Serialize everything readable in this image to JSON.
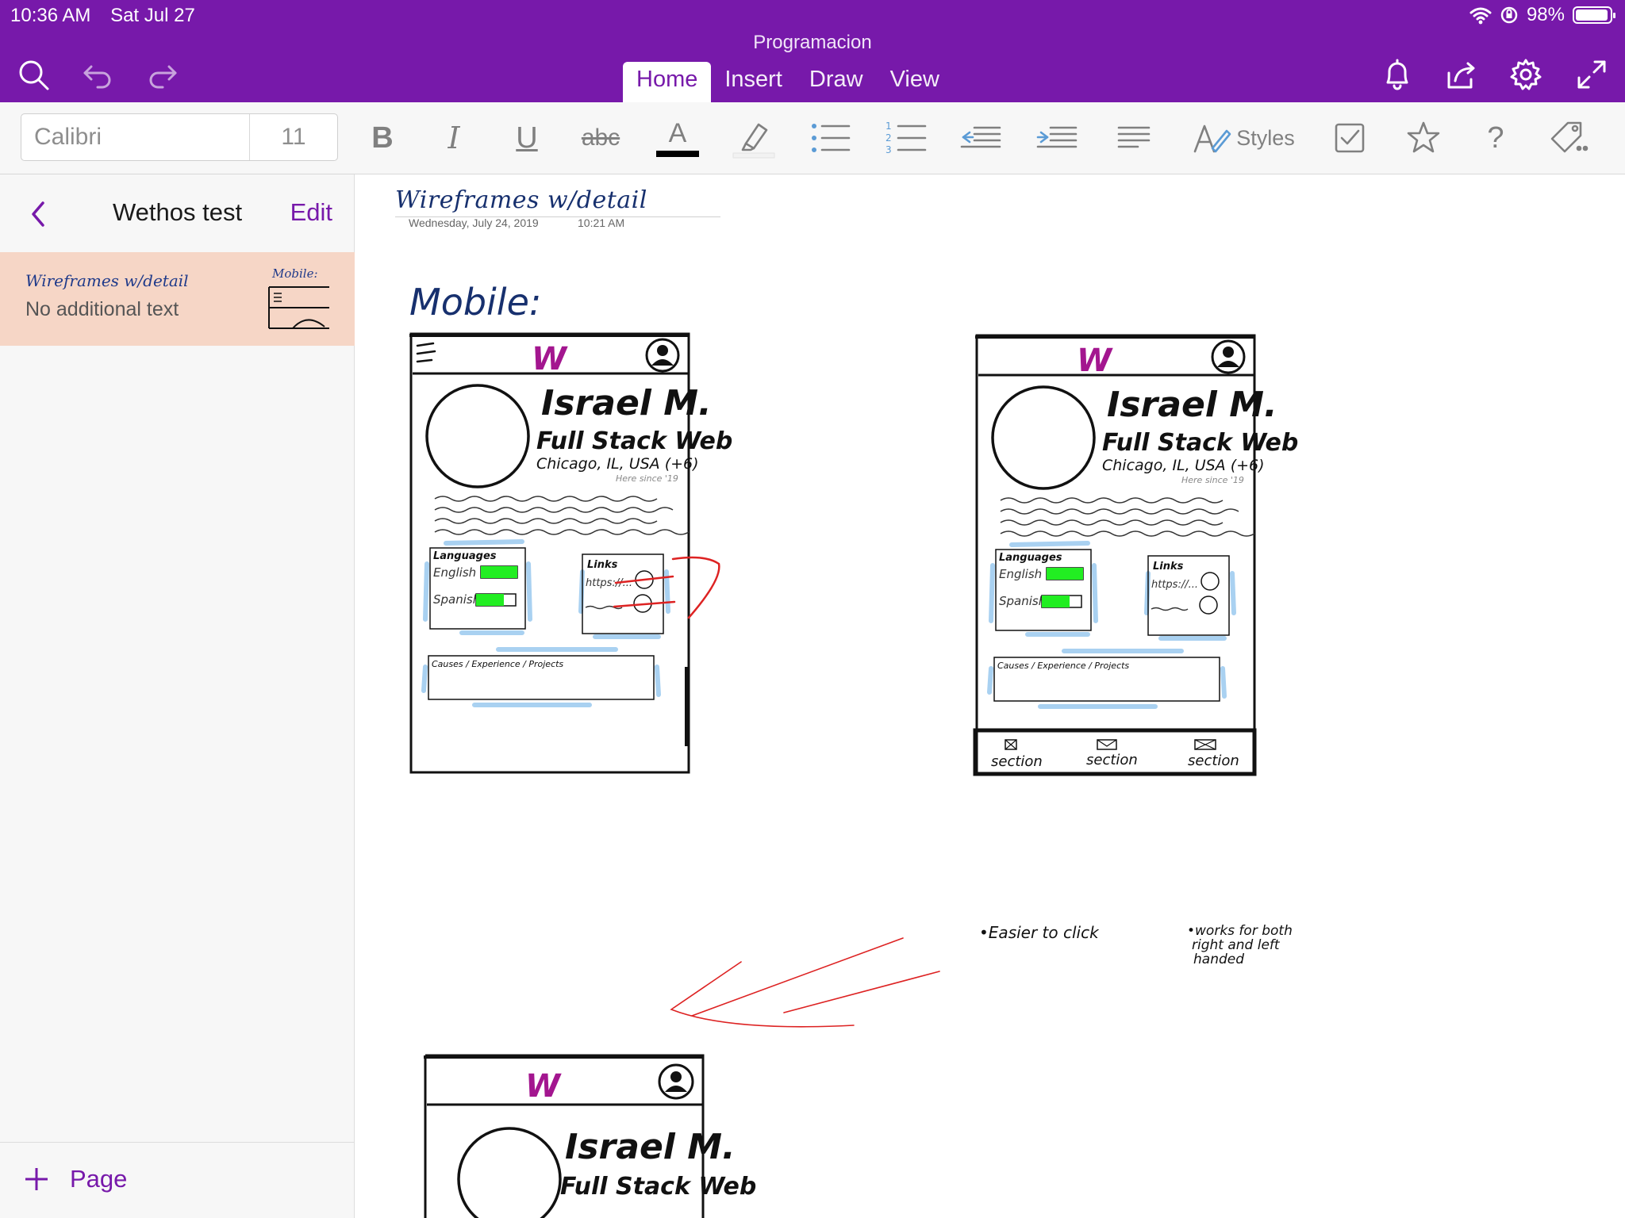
{
  "status": {
    "time": "10:36 AM",
    "date": "Sat Jul 27",
    "battery": "98%"
  },
  "app": {
    "notebook_title": "Programacion"
  },
  "tabs": [
    "Home",
    "Insert",
    "Draw",
    "View"
  ],
  "ribbon": {
    "font_name": "Calibri",
    "font_size": "11",
    "styles_label": "Styles"
  },
  "sidebar": {
    "section_name": "Wethos test",
    "edit_label": "Edit",
    "pages": [
      {
        "title": "Wireframes w/detail",
        "preview": "No additional text",
        "thumb_text": "Mobile:"
      }
    ],
    "add_page_label": "Page"
  },
  "page": {
    "title": "Wireframes w/detail",
    "date": "Wednesday, July 24, 2019",
    "time": "10:21 AM"
  },
  "sketch": {
    "heading": "Mobile:",
    "name": "Israel M.",
    "role": "Full Stack Web",
    "location": "Chicago, IL, USA (+6)",
    "since": "Here since '19",
    "languages_title": "Languages",
    "languages": [
      {
        "name": "English",
        "level": 1.0
      },
      {
        "name": "Spanish",
        "level": 0.7
      }
    ],
    "links_title": "Links",
    "link_text": "https://...",
    "causes_title": "Causes / Experience / Projects",
    "nav_labels": [
      "section",
      "section",
      "section"
    ],
    "note_left": "•Easier to click",
    "note_right_lines": [
      "•works for both",
      "right and left",
      "handed"
    ],
    "logo_letter": "W",
    "colors": {
      "ink": "#111111",
      "logo": "#a3168f",
      "highlight": "#9ac9ee",
      "bar": "#22ee22",
      "arrow": "#dd2222"
    }
  }
}
